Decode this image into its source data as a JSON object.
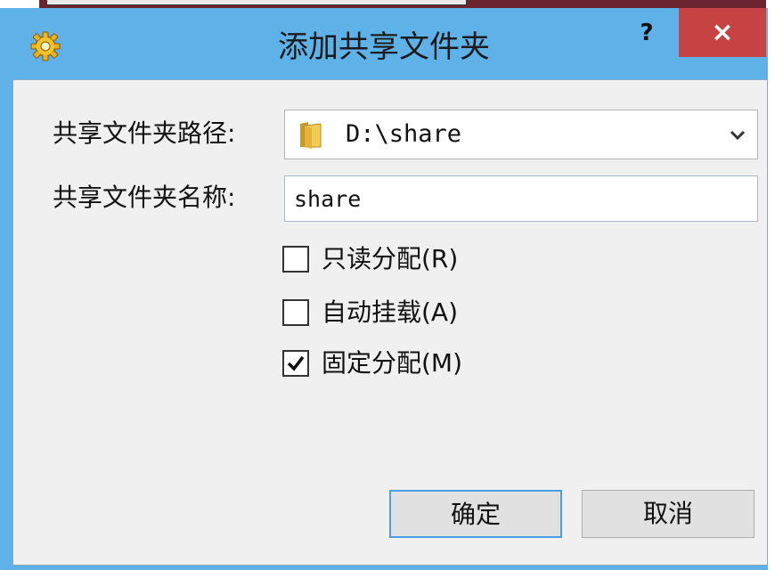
{
  "window": {
    "title": "添加共享文件夹",
    "help_label": "?",
    "close_label": "×"
  },
  "form": {
    "path_label": "共享文件夹路径:",
    "path_value": "D:\\share",
    "name_label": "共享文件夹名称:",
    "name_value": "share"
  },
  "options": [
    {
      "label": "只读分配(R)",
      "checked": false
    },
    {
      "label": "自动挂载(A)",
      "checked": false
    },
    {
      "label": "固定分配(M)",
      "checked": true
    }
  ],
  "buttons": {
    "ok_label": "确定",
    "cancel_label": "取消"
  },
  "colors": {
    "titlebar": "#5fb2e8",
    "close": "#c74343",
    "client": "#f0f0f0",
    "ok_border": "#4a9ee3"
  }
}
